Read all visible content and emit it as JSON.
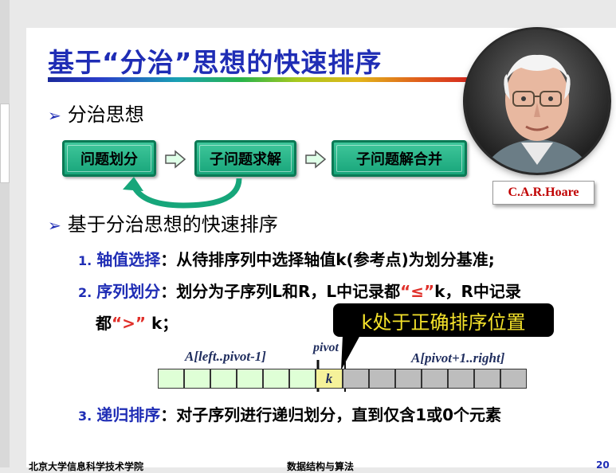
{
  "slide": {
    "title": "基于“分治”思想的快速排序",
    "portrait_caption": "C.A.R.Hoare",
    "bullet1": "分治思想",
    "flow": [
      "问题划分",
      "子问题求解",
      "子问题解合并"
    ],
    "bullet2": "基于分治思想的快速排序",
    "items": [
      {
        "num": "1.",
        "keyword": "轴值选择",
        "text": "：从待排序列中选择轴值k(参考点)为划分基准;"
      },
      {
        "num": "2.",
        "keyword": "序列划分",
        "text_a": "：划分为子序列L和R，L中记录都",
        "le": "“≤”",
        "text_b": "k，R中记录",
        "text_c": "都",
        "gt": "“>”",
        "text_d": " k；"
      },
      {
        "num": "3.",
        "keyword": "递归排序",
        "text": "：对子序列进行递归划分，直到仅含1或0个元素"
      }
    ],
    "callout": "k处于正确排序位置",
    "array": {
      "left_label": "A[left..pivot-1]",
      "pivot_label": "pivot",
      "right_label": "A[pivot+1..right]",
      "pivot_value": "k",
      "left_cells": 6,
      "right_cells": 7
    },
    "footer_left": "北京大学信息科学技术学院",
    "footer_center": "数据结构与算法",
    "footer_right": "20"
  },
  "colors": {
    "title": "#1f2db5",
    "box_fill": "#18a57a",
    "callout_bg": "#000000",
    "callout_text": "#f3e12a",
    "accent_red": "#e0302a"
  }
}
